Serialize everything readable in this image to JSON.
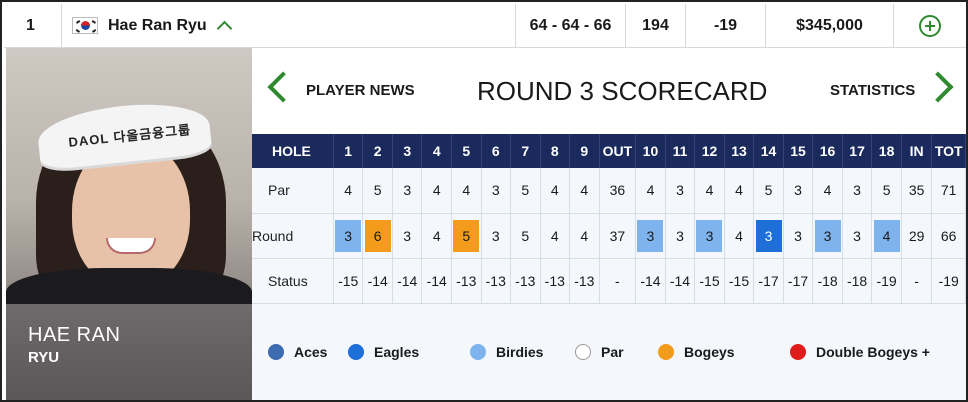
{
  "leaderboard_row": {
    "position": "1",
    "player_name": "Hae Ran Ryu",
    "rounds": "64 - 64 - 66",
    "total": "194",
    "to_par": "-19",
    "earnings": "$345,000",
    "flag_icon": "south-korea-flag-icon",
    "expand_icon": "chevron-up-icon",
    "add_icon": "plus-circle-icon"
  },
  "player_card": {
    "first_name": "HAE RAN",
    "last_name": "RYU",
    "visor_text": "DAOL 다올금융그룹"
  },
  "nav": {
    "prev_label": "PLAYER NEWS",
    "title": "ROUND 3 SCORECARD",
    "next_label": "STATISTICS"
  },
  "scorecard": {
    "header": [
      "HOLE",
      "1",
      "2",
      "3",
      "4",
      "5",
      "6",
      "7",
      "8",
      "9",
      "OUT",
      "10",
      "11",
      "12",
      "13",
      "14",
      "15",
      "16",
      "17",
      "18",
      "IN",
      "TOT"
    ],
    "rows": [
      {
        "label": "Par",
        "cells": [
          "4",
          "5",
          "3",
          "4",
          "4",
          "3",
          "5",
          "4",
          "4",
          "36",
          "4",
          "3",
          "4",
          "4",
          "5",
          "3",
          "4",
          "3",
          "5",
          "35",
          "71"
        ]
      },
      {
        "label": "Round",
        "cells": [
          "3",
          "6",
          "3",
          "4",
          "5",
          "3",
          "5",
          "4",
          "4",
          "37",
          "3",
          "3",
          "3",
          "4",
          "3",
          "3",
          "3",
          "3",
          "4",
          "29",
          "66"
        ],
        "results": [
          "birdie",
          "bogey",
          "par",
          "par",
          "bogey",
          "par",
          "par",
          "par",
          "par",
          "",
          "birdie",
          "par",
          "birdie",
          "par",
          "eagle",
          "par",
          "birdie",
          "par",
          "birdie",
          "",
          ""
        ]
      },
      {
        "label": "Status",
        "cells": [
          "-15",
          "-14",
          "-14",
          "-14",
          "-13",
          "-13",
          "-13",
          "-13",
          "-13",
          "-",
          "-14",
          "-14",
          "-15",
          "-15",
          "-17",
          "-17",
          "-18",
          "-18",
          "-19",
          "-",
          "-19"
        ]
      }
    ]
  },
  "legend": [
    {
      "label": "Aces",
      "color": "#3d6db0"
    },
    {
      "label": "Eagles",
      "color": "#1e6fd8"
    },
    {
      "label": "Birdies",
      "color": "#7fb3ee"
    },
    {
      "label": "Par",
      "color": "#ffffff"
    },
    {
      "label": "Bogeys",
      "color": "#f39b1b"
    },
    {
      "label": "Double Bogeys +",
      "color": "#e01b1b"
    }
  ],
  "colors": {
    "accent_green": "#2f8a2f",
    "header_navy": "#1a2a5c"
  }
}
